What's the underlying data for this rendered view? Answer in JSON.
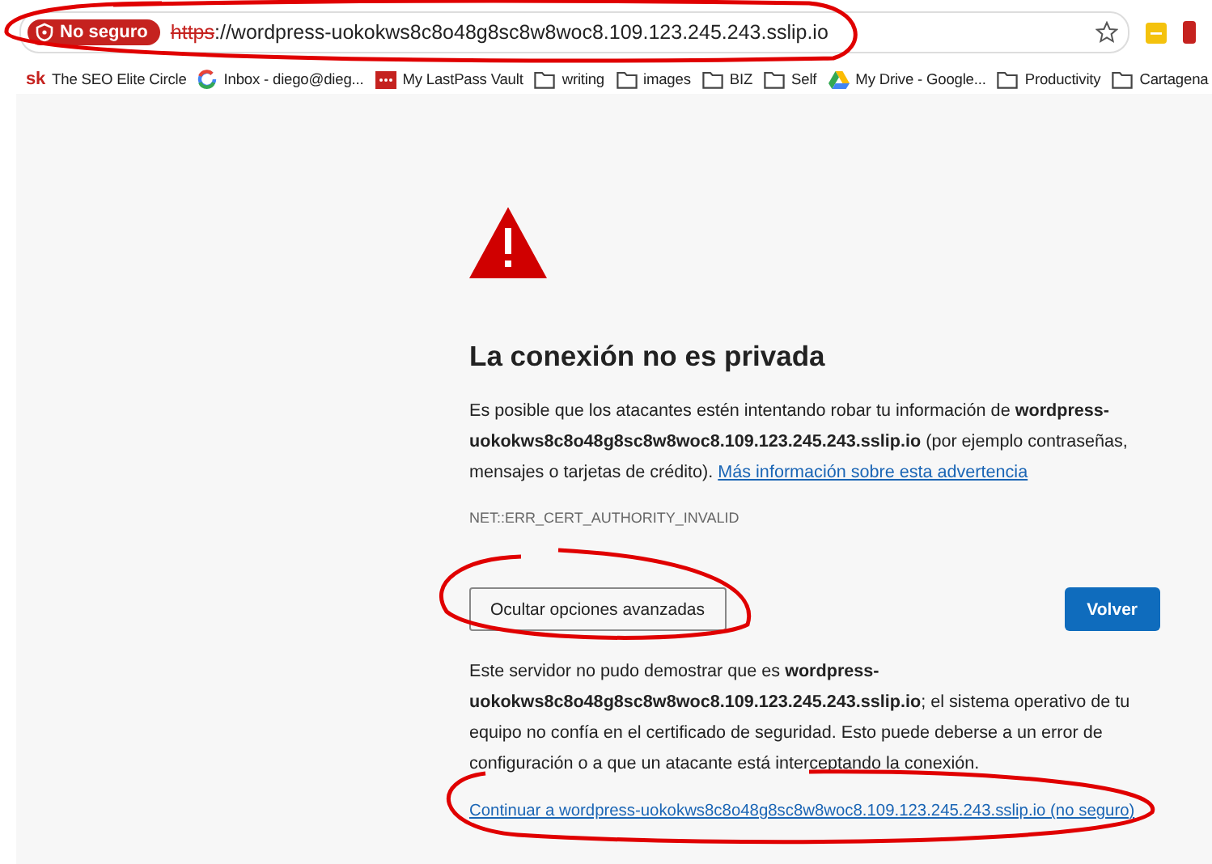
{
  "address_bar": {
    "security_label": "No seguro",
    "secure": false,
    "scheme": "https",
    "url_rest": "://wordpress-uokokws8c8o48g8sc8w8woc8.109.123.245.243.sslip.io"
  },
  "bookmarks": [
    {
      "kind": "text-logo",
      "logo_text": "sk",
      "label": "The SEO Elite Circle"
    },
    {
      "kind": "google",
      "label": "Inbox - diego@dieg..."
    },
    {
      "kind": "lastpass",
      "label": "My LastPass Vault"
    },
    {
      "kind": "folder",
      "label": "writing"
    },
    {
      "kind": "folder",
      "label": "images"
    },
    {
      "kind": "folder",
      "label": "BIZ"
    },
    {
      "kind": "folder",
      "label": "Self"
    },
    {
      "kind": "drive",
      "label": "My Drive - Google..."
    },
    {
      "kind": "folder",
      "label": "Productivity"
    },
    {
      "kind": "folder",
      "label": "Cartagena"
    }
  ],
  "error_page": {
    "heading": "La conexión no es privada",
    "intro": "Es posible que los atacantes estén intentando robar tu información de **wordpress-uokokws8c8o48g8sc8w8woc8.109.123.245.243.sslip.io** (por ejemplo contraseñas, mensajes o tarjetas de crédito).",
    "intro_link": "Más información sobre esta advertencia",
    "error_code": "NET::ERR_CERT_AUTHORITY_INVALID",
    "buttons": [
      {
        "kind": "secondary",
        "label": "Ocultar opciones avanzadas"
      },
      {
        "kind": "primary",
        "label": "Volver"
      }
    ],
    "details": "Este servidor no pudo demostrar que es **wordpress-uokokws8c8o48g8sc8w8woc8.109.123.245.243.sslip.io**; el sistema operativo de tu equipo no confía en el certificado de seguridad. Esto puede deberse a un error de configuración o a que un atacante está interceptando la conexión.",
    "proceed_link": "Continuar a wordpress-uokokws8c8o48g8sc8w8woc8.109.123.245.243.sslip.io (no seguro)"
  }
}
